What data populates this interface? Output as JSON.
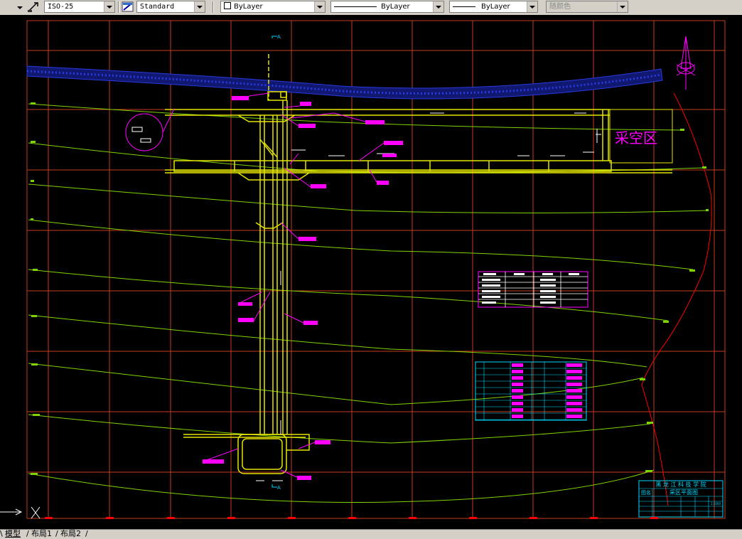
{
  "toolbar": {
    "dimstyle": "ISO-25",
    "textstyle": "Standard",
    "layer": "ByLayer",
    "linetype": "ByLayer",
    "lineweight": "ByLayer",
    "plotstyle": "随颜色"
  },
  "drawing": {
    "area_label": "采空区",
    "north_symbol": "north-arrow-icon",
    "section_marks": [
      "A",
      "A"
    ],
    "title_block": {
      "institution": "黑 龙 江 科 技 学 院",
      "name_label": "图名",
      "drawing_name": "采区平面图",
      "scale": "1:2000"
    }
  },
  "layout_tabs": [
    "模型",
    "布局1",
    "布局2"
  ],
  "colors": {
    "background": "#000000",
    "grid": "#c83c1e",
    "contour": "#7fd400",
    "roadway": "#e6e600",
    "labels": "#ff00ff",
    "river": "#2030c0",
    "boundary": "#ff0000",
    "table": "#00d8ff"
  }
}
